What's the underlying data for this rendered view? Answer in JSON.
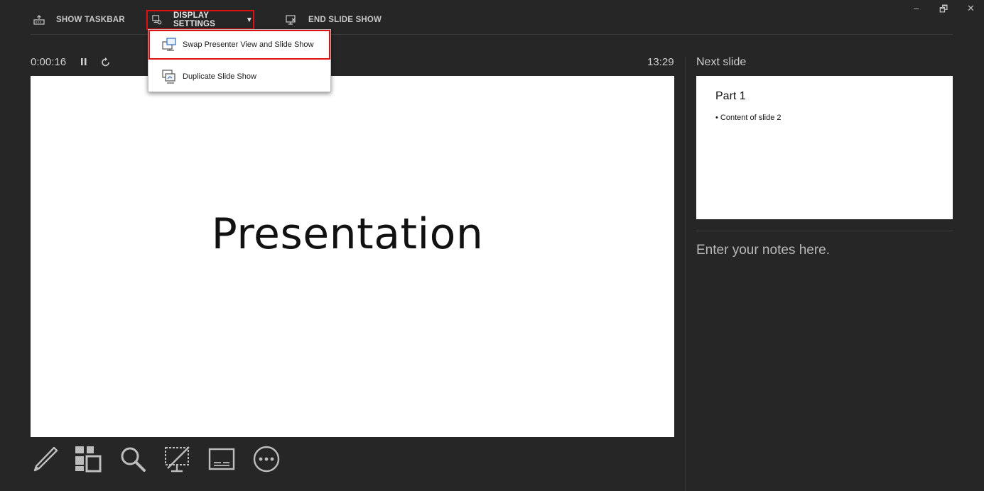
{
  "toolbar": {
    "show_taskbar": "SHOW TASKBAR",
    "display_settings": "DISPLAY SETTINGS",
    "end_slide_show": "END SLIDE SHOW"
  },
  "window_controls": {
    "minimize": "–",
    "restore": "🗗",
    "close": "✕"
  },
  "timer": {
    "elapsed": "0:00:16",
    "clock": "13:29"
  },
  "current_slide": {
    "title": "Presentation"
  },
  "next_slide": {
    "label": "Next slide",
    "title": "Part 1",
    "bullet": "• Content of slide 2"
  },
  "notes": {
    "placeholder": "Enter your notes here."
  },
  "display_menu": {
    "items": [
      {
        "label": "Swap Presenter View and Slide Show",
        "icon": "swap-screens-icon"
      },
      {
        "label": "Duplicate Slide Show",
        "icon": "duplicate-screen-icon"
      }
    ]
  },
  "tools": [
    "pen-icon",
    "slides-grid-icon",
    "zoom-icon",
    "black-screen-icon",
    "subtitles-icon",
    "more-options-icon"
  ],
  "colors": {
    "background": "#262626",
    "highlight": "#dd1111",
    "slide": "#ffffff"
  }
}
